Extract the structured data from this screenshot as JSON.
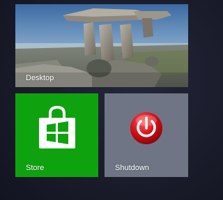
{
  "tiles": {
    "desktop": {
      "label": "Desktop"
    },
    "store": {
      "label": "Store",
      "color": "#0ea30e",
      "icon": "store-bag-icon"
    },
    "shutdown": {
      "label": "Shutdown",
      "color": "#6f7584",
      "icon": "power-icon"
    }
  },
  "colors": {
    "background": "#1a1c2b",
    "store_tile": "#0ea30e",
    "shutdown_tile": "#6f7584",
    "power_red": "#d20f16"
  }
}
